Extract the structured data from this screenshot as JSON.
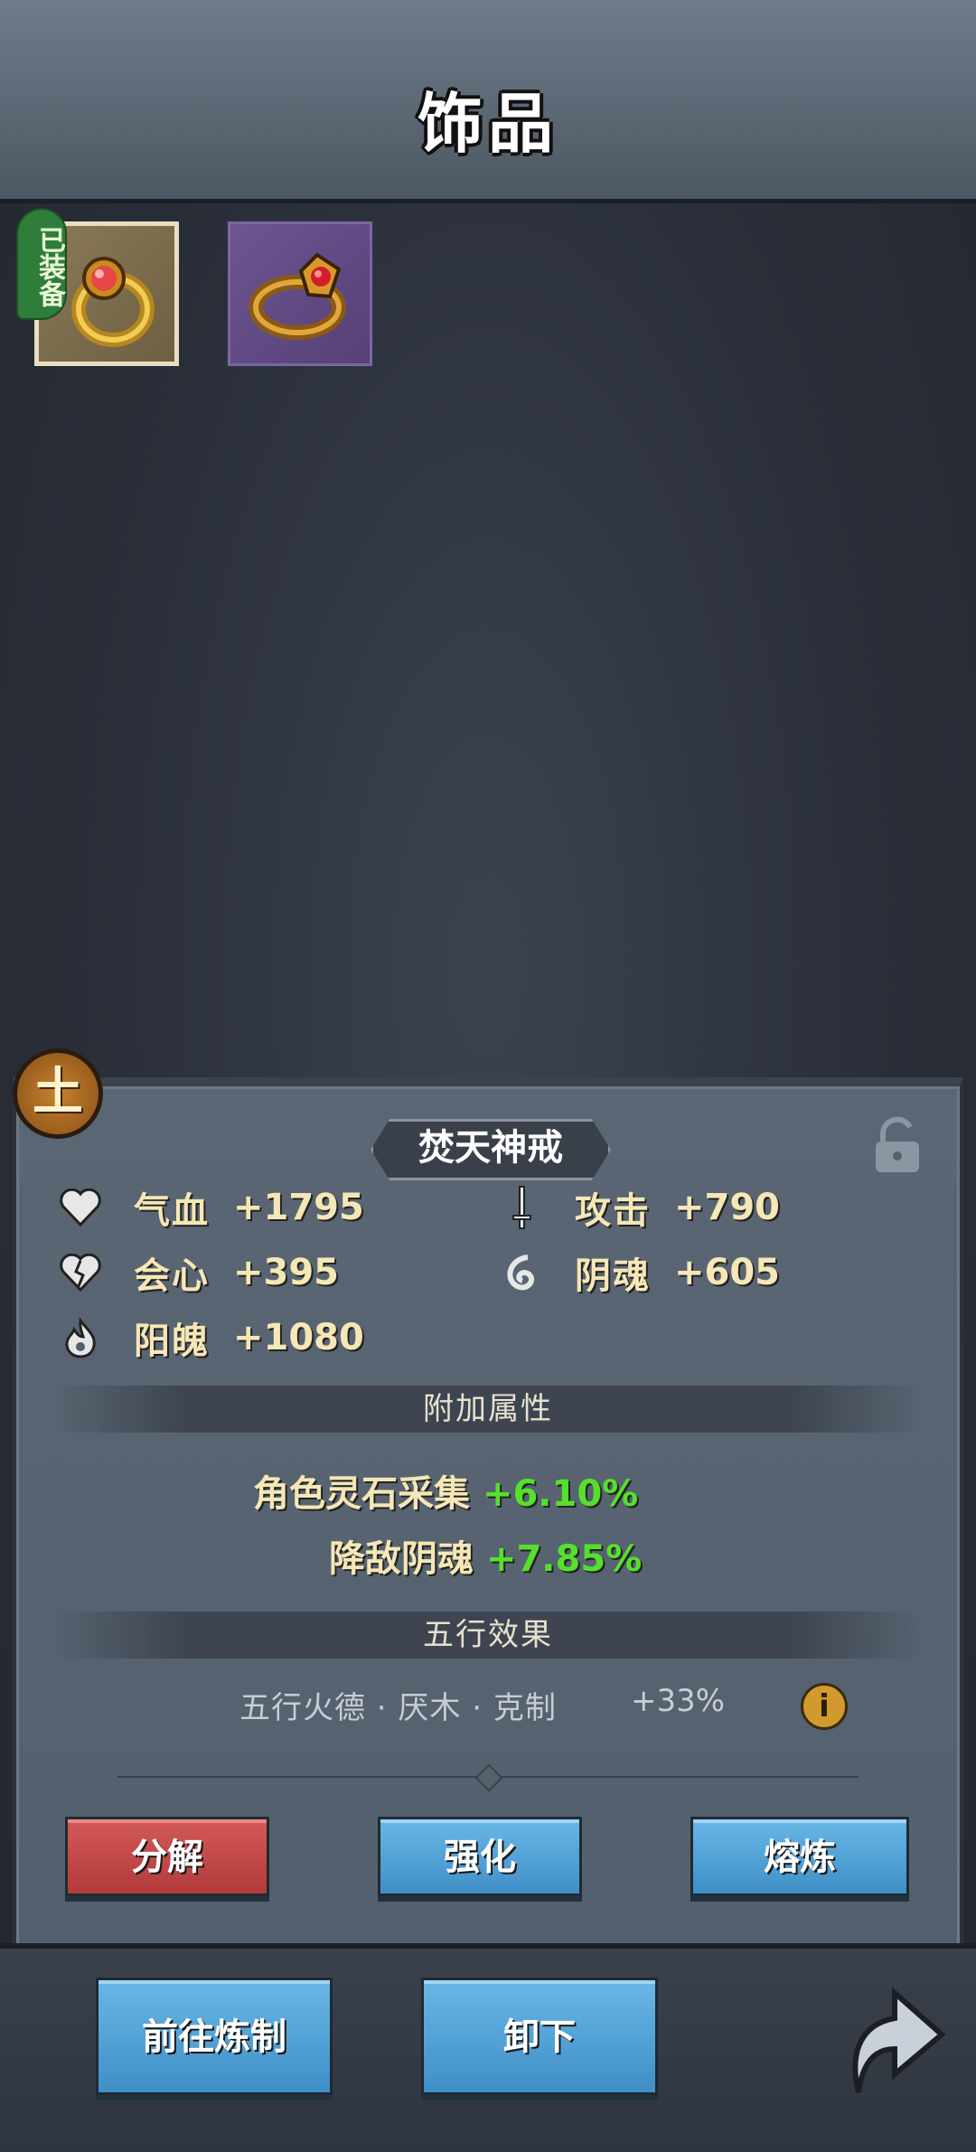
{
  "header": {
    "title": "饰品"
  },
  "inventory": {
    "items": [
      {
        "name": "ring-gold-red-gem",
        "equipped": true,
        "badge": "已装备",
        "rarity_color": "#8a7a58"
      },
      {
        "name": "ring-gold-ruby",
        "equipped": false,
        "rarity_color": "#6d5690"
      }
    ]
  },
  "detail": {
    "element": "土",
    "name": "焚天神戒",
    "locked": false,
    "base_stats": [
      {
        "icon": "heart-icon",
        "label": "气血",
        "value": "+1795"
      },
      {
        "icon": "sword-icon",
        "label": "攻击",
        "value": "+790"
      },
      {
        "icon": "broken-heart-icon",
        "label": "会心",
        "value": "+395"
      },
      {
        "icon": "spiral-icon",
        "label": "阴魂",
        "value": "+605"
      },
      {
        "icon": "flame-icon",
        "label": "阳魄",
        "value": "+1080"
      }
    ],
    "extra_section_title": "附加属性",
    "extra_stats": [
      {
        "label": "角色灵石采集",
        "value": "+6.10%"
      },
      {
        "label": "降敌阴魂",
        "value": "+7.85%"
      }
    ],
    "wuxing_section_title": "五行效果",
    "wuxing_effect": "五行火德 · 厌木 · 克制",
    "wuxing_value": "+33%",
    "info_icon_label": "i"
  },
  "actions": {
    "decompose": "分解",
    "enhance": "强化",
    "smelt": "熔炼",
    "go_forge": "前往炼制",
    "unequip": "卸下"
  },
  "colors": {
    "positive": "#56e02b",
    "button_blue": "#4f9fd6",
    "button_red": "#c44848"
  }
}
